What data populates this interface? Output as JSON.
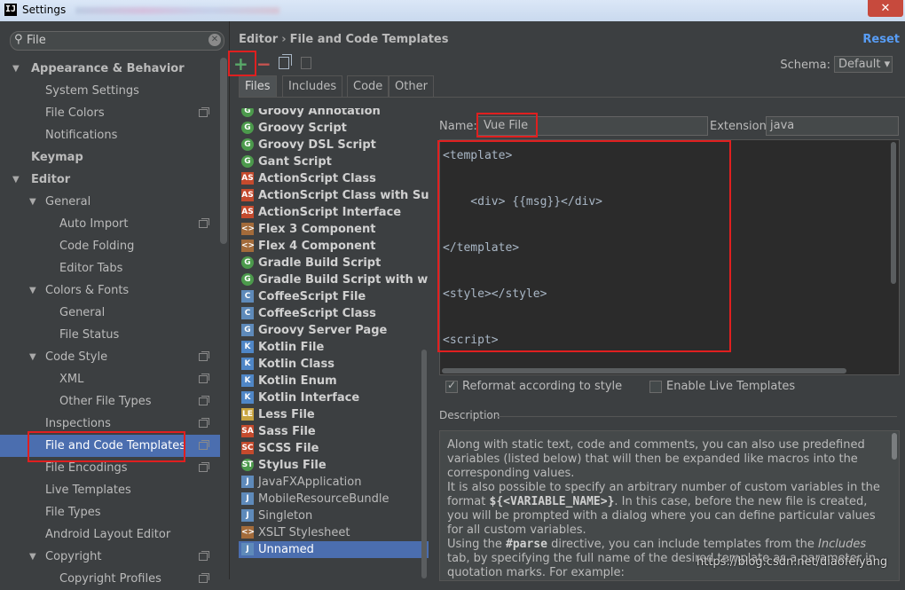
{
  "window": {
    "icon": "IJ",
    "title": "Settings",
    "close": "✕"
  },
  "search": {
    "value": "File",
    "placeholder": ""
  },
  "tree": [
    {
      "label": "Appearance & Behavior",
      "level": 0,
      "bold": true,
      "arrow": "▼"
    },
    {
      "label": "System Settings",
      "level": 1
    },
    {
      "label": "File Colors",
      "level": 1,
      "proj": true
    },
    {
      "label": "Notifications",
      "level": 1
    },
    {
      "label": "Keymap",
      "level": 0,
      "bold": true
    },
    {
      "label": "Editor",
      "level": 0,
      "bold": true,
      "arrow": "▼"
    },
    {
      "label": "General",
      "level": 1,
      "arrow": "▼"
    },
    {
      "label": "Auto Import",
      "level": 2,
      "proj": true
    },
    {
      "label": "Code Folding",
      "level": 2
    },
    {
      "label": "Editor Tabs",
      "level": 2
    },
    {
      "label": "Colors & Fonts",
      "level": 1,
      "arrow": "▼"
    },
    {
      "label": "General",
      "level": 2
    },
    {
      "label": "File Status",
      "level": 2
    },
    {
      "label": "Code Style",
      "level": 1,
      "arrow": "▼",
      "proj": true
    },
    {
      "label": "XML",
      "level": 2,
      "proj": true
    },
    {
      "label": "Other File Types",
      "level": 2,
      "proj": true
    },
    {
      "label": "Inspections",
      "level": 1,
      "proj": true
    },
    {
      "label": "File and Code Templates",
      "level": 1,
      "proj": true,
      "selected": true
    },
    {
      "label": "File Encodings",
      "level": 1,
      "proj": true
    },
    {
      "label": "Live Templates",
      "level": 1
    },
    {
      "label": "File Types",
      "level": 1
    },
    {
      "label": "Android Layout Editor",
      "level": 1
    },
    {
      "label": "Copyright",
      "level": 1,
      "arrow": "▼",
      "proj": true
    },
    {
      "label": "Copyright Profiles",
      "level": 2,
      "proj": true
    }
  ],
  "breadcrumb": {
    "parent": "Editor",
    "sep": "›",
    "current": "File and Code Templates"
  },
  "reset_label": "Reset",
  "toolbar": {
    "add": "+",
    "remove": "−"
  },
  "schema": {
    "label": "Schema:",
    "value": "Default ▾"
  },
  "tabs": [
    "Files",
    "Includes",
    "Code",
    "Other"
  ],
  "templates": [
    {
      "label": "Groovy Annotation",
      "icon": "G",
      "kind": "g",
      "bold": true
    },
    {
      "label": "Groovy Script",
      "icon": "G",
      "kind": "g",
      "bold": true
    },
    {
      "label": "Groovy DSL Script",
      "icon": "G",
      "kind": "g",
      "bold": true
    },
    {
      "label": "Gant Script",
      "icon": "G",
      "kind": "g",
      "bold": true
    },
    {
      "label": "ActionScript Class",
      "icon": "AS",
      "kind": "as",
      "bold": true
    },
    {
      "label": "ActionScript Class with Supers",
      "icon": "AS",
      "kind": "as",
      "bold": true
    },
    {
      "label": "ActionScript Interface",
      "icon": "AS",
      "kind": "as",
      "bold": true
    },
    {
      "label": "Flex 3 Component",
      "icon": "<>",
      "kind": "fx",
      "bold": true
    },
    {
      "label": "Flex 4 Component",
      "icon": "<>",
      "kind": "fx",
      "bold": true
    },
    {
      "label": "Gradle Build Script",
      "icon": "G",
      "kind": "g",
      "bold": true
    },
    {
      "label": "Gradle Build Script with wrapper",
      "icon": "G",
      "kind": "g",
      "bold": true
    },
    {
      "label": "CoffeeScript File",
      "icon": "C",
      "kind": "f",
      "bold": true
    },
    {
      "label": "CoffeeScript Class",
      "icon": "C",
      "kind": "f",
      "bold": true
    },
    {
      "label": "Groovy Server Page",
      "icon": "G",
      "kind": "f",
      "bold": true
    },
    {
      "label": "Kotlin File",
      "icon": "K",
      "kind": "k",
      "bold": true
    },
    {
      "label": "Kotlin Class",
      "icon": "K",
      "kind": "k",
      "bold": true
    },
    {
      "label": "Kotlin Enum",
      "icon": "K",
      "kind": "k",
      "bold": true
    },
    {
      "label": "Kotlin Interface",
      "icon": "K",
      "kind": "k",
      "bold": true
    },
    {
      "label": "Less File",
      "icon": "LE",
      "kind": "css",
      "bold": true
    },
    {
      "label": "Sass File",
      "icon": "SA",
      "kind": "as",
      "bold": true
    },
    {
      "label": "SCSS File",
      "icon": "SC",
      "kind": "as",
      "bold": true
    },
    {
      "label": "Stylus File",
      "icon": "ST",
      "kind": "g",
      "bold": true
    },
    {
      "label": "JavaFXApplication",
      "icon": "J",
      "kind": "f",
      "bold": false
    },
    {
      "label": "MobileResourceBundle",
      "icon": "J",
      "kind": "f",
      "bold": false
    },
    {
      "label": "Singleton",
      "icon": "J",
      "kind": "f",
      "bold": false
    },
    {
      "label": "XSLT Stylesheet",
      "icon": "<>",
      "kind": "fx",
      "bold": false
    },
    {
      "label": "Unnamed",
      "icon": "J",
      "kind": "f",
      "bold": false,
      "selected": true
    }
  ],
  "form": {
    "name_label": "Name:",
    "name_value": "Vue File",
    "ext_label": "Extension:",
    "ext_value": "java"
  },
  "editor_code": "<template>\n\n    <div> {{msg}}</div>\n\n</template>\n\n<style></style>\n\n<script>",
  "options": {
    "reformat": "Reformat according to style",
    "live": "Enable Live Templates"
  },
  "description": {
    "label": "Description",
    "p1": "Along with static text, code and comments, you can also use predefined variables (listed below) that will then be expanded like macros into the corresponding values.",
    "p2a": "It is also possible to specify an arbitrary number of custom variables in the format ",
    "p2b": "${<VARIABLE_NAME>}",
    "p2c": ". In this case, before the new file is created, you will be prompted with a dialog where you can define particular values for all custom variables.",
    "p3a": "Using the ",
    "p3b": "#parse",
    "p3c": " directive, you can include templates from the ",
    "p3d": "Includes",
    "p3e": " tab, by specifying the full name of the desired template as a parameter in quotation marks. For example:"
  },
  "watermark": "https://blog.csdn.net/diaofeiyang",
  "colors": {
    "accent": "#4b6eaf",
    "link": "#589df6",
    "highlight": "#e01f1f",
    "add": "#59a869"
  }
}
